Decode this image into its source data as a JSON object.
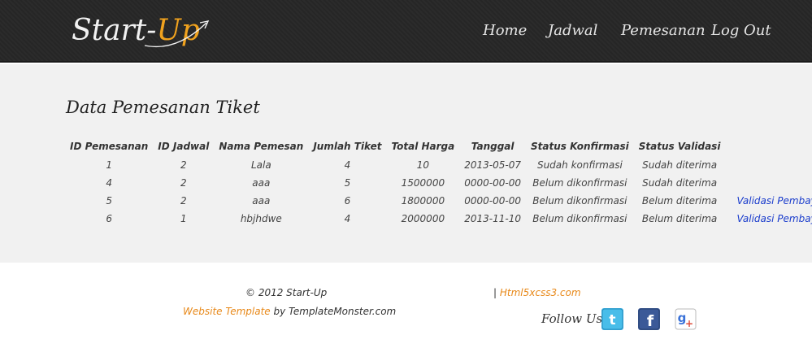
{
  "header": {
    "logo_main": "Start-",
    "logo_accent": "Up",
    "nav": [
      {
        "label": "Home"
      },
      {
        "label": "Jadwal"
      },
      {
        "label": "Pemesanan"
      },
      {
        "label": "Log Out"
      }
    ]
  },
  "main": {
    "title": "Data Pemesanan Tiket",
    "columns": [
      "ID Pemesanan",
      "ID Jadwal",
      "Nama Pemesan",
      "Jumlah Tiket",
      "Total Harga",
      "Tanggal",
      "Status Konfirmasi",
      "Status Validasi"
    ],
    "rows": [
      {
        "id": "1",
        "jadwal": "2",
        "nama": "Lala",
        "jumlah": "4",
        "total": "10",
        "tanggal": "2013-05-07",
        "konfirmasi": "Sudah konfirmasi",
        "validasi": "Sudah diterima",
        "action": ""
      },
      {
        "id": "4",
        "jadwal": "2",
        "nama": "aaa",
        "jumlah": "5",
        "total": "1500000",
        "tanggal": "0000-00-00",
        "konfirmasi": "Belum dikonfirmasi",
        "validasi": "Sudah diterima",
        "action": ""
      },
      {
        "id": "5",
        "jadwal": "2",
        "nama": "aaa",
        "jumlah": "6",
        "total": "1800000",
        "tanggal": "0000-00-00",
        "konfirmasi": "Belum dikonfirmasi",
        "validasi": "Belum diterima",
        "action": "Validasi Pembayaran"
      },
      {
        "id": "6",
        "jadwal": "1",
        "nama": "hbjhdwe",
        "jumlah": "4",
        "total": "2000000",
        "tanggal": "2013-11-10",
        "konfirmasi": "Belum dikonfirmasi",
        "validasi": "Belum diterima",
        "action": "Validasi Pembayaran"
      }
    ]
  },
  "footer": {
    "copyright": "© 2012 Start-Up",
    "template_link": "Website Template",
    "template_by": " by TemplateMonster.com",
    "sep": "| ",
    "html5_link": "Html5xcss3.com",
    "follow_label": "Follow Us:",
    "social": [
      {
        "icon": "twitter-icon",
        "color": "#3ab0e2"
      },
      {
        "icon": "facebook-icon",
        "color": "#3b5998"
      },
      {
        "icon": "google-icon",
        "color": "#dd4b39"
      }
    ]
  }
}
